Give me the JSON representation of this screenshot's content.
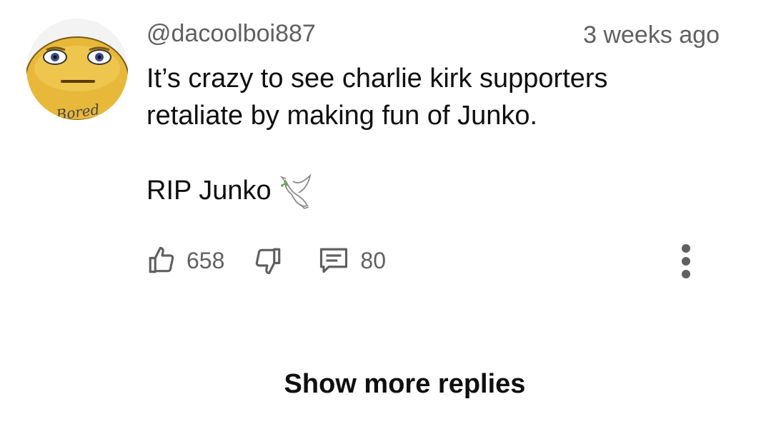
{
  "comment": {
    "username": "@dacoolboi887",
    "timestamp": "3 weeks ago",
    "avatar_text": "Bored",
    "lines": [
      "It’s crazy to see charlie kirk supporters",
      "retaliate by making fun of Junko."
    ],
    "second_paragraph": "RIP Junko",
    "emoji": "dove-icon",
    "likes": "658",
    "replies": "80"
  },
  "show_more_label": "Show more replies",
  "colors": {
    "text": "#0f0f0f",
    "secondary": "#606060",
    "avatar_face": "#e8b83a"
  }
}
